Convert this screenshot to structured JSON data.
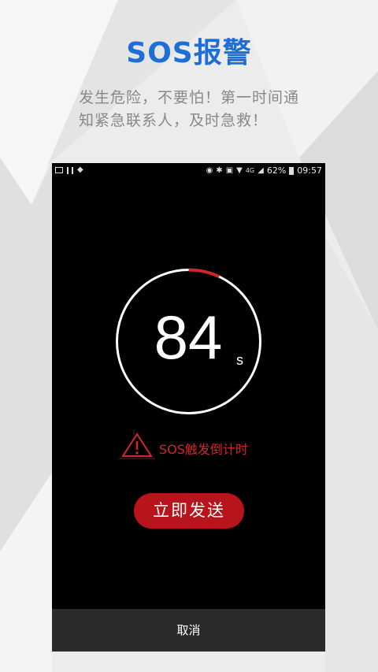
{
  "promo": {
    "title": "SOS报警",
    "description": "发生危险，不要怕！第一时间通知紧急联系人，及时急救！"
  },
  "status_bar": {
    "network": "4G",
    "battery": "62%",
    "time": "09:57"
  },
  "countdown": {
    "value": "84",
    "unit": "s",
    "remaining_fraction": 0.93
  },
  "trigger_label": "SOS触发倒计时",
  "send_button": "立即发送",
  "cancel_button": "取消",
  "colors": {
    "accent_blue": "#1d6fd6",
    "alert_red": "#d4262a",
    "button_red": "#b8141b"
  },
  "icons": [
    "location-icon",
    "bluetooth-icon",
    "nfc-icon",
    "wifi-icon",
    "signal-icon",
    "battery-icon",
    "warning-icon"
  ]
}
